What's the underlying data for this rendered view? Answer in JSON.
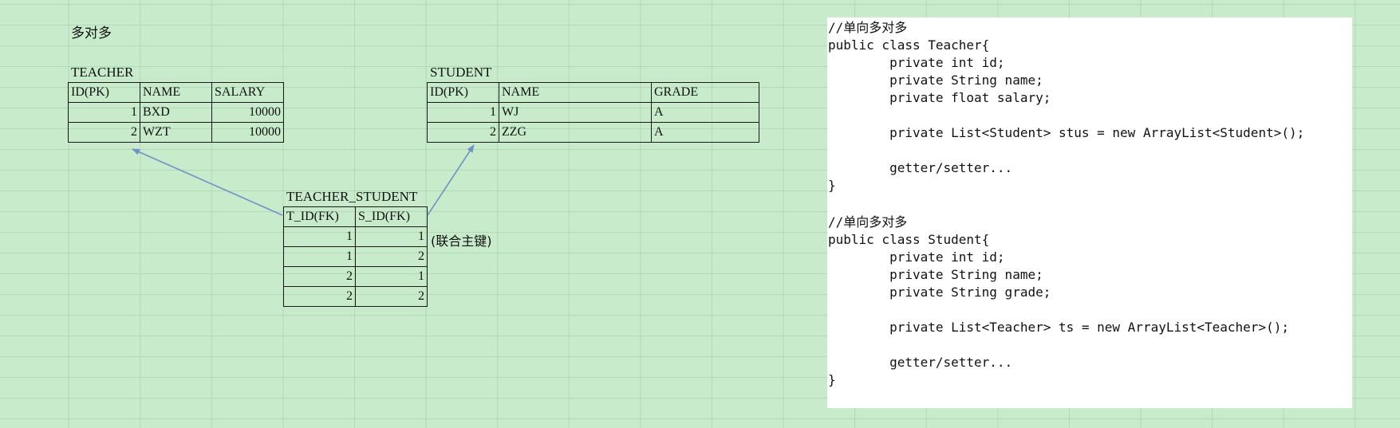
{
  "heading": "多对多",
  "teacher": {
    "label": "TEACHER",
    "headers": [
      "ID(PK)",
      "NAME",
      "SALARY"
    ],
    "rows": [
      [
        "1",
        "BXD",
        "10000"
      ],
      [
        "2",
        "WZT",
        "10000"
      ]
    ]
  },
  "student": {
    "label": "STUDENT",
    "headers": [
      "ID(PK)",
      "NAME",
      "GRADE"
    ],
    "rows": [
      [
        "1",
        "WJ",
        "A"
      ],
      [
        "2",
        "ZZG",
        "A"
      ]
    ]
  },
  "join": {
    "label": "TEACHER_STUDENT",
    "headers": [
      "T_ID(FK)",
      "S_ID(FK)"
    ],
    "rows": [
      [
        "1",
        "1"
      ],
      [
        "1",
        "2"
      ],
      [
        "2",
        "1"
      ],
      [
        "2",
        "2"
      ]
    ],
    "note": "(联合主键)"
  },
  "colors": {
    "background": "#c7ebcb",
    "arrow": "#6e93c6",
    "code_panel": "#ffffff"
  },
  "code": {
    "teacher_class": "//单向多对多\npublic class Teacher{\n        private int id;\n        private String name;\n        private float salary;\n\n        private List<Student> stus = new ArrayList<Student>();\n\n        getter/setter...\n}",
    "student_class": "//单向多对多\npublic class Student{\n        private int id;\n        private String name;\n        private String grade;\n\n        private List<Teacher> ts = new ArrayList<Teacher>();\n\n        getter/setter...\n}"
  }
}
